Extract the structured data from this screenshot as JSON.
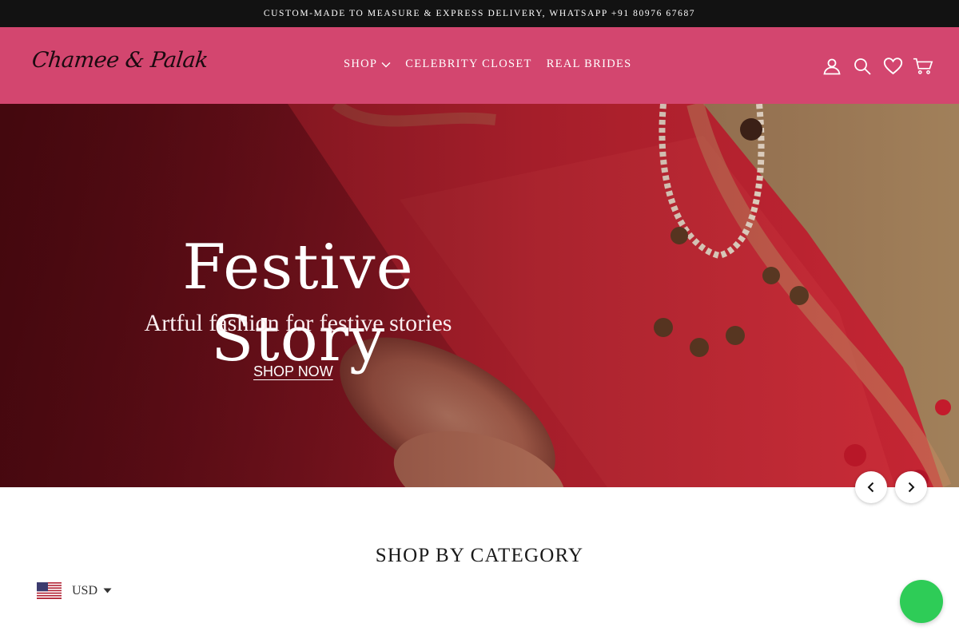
{
  "announcement": {
    "text": "CUSTOM-MADE TO MEASURE & EXPRESS DELIVERY, WHATSAPP +91 80976 67687"
  },
  "header": {
    "logo_text": "Chamee & Palak",
    "nav": [
      {
        "label": "SHOP"
      },
      {
        "label": "CELEBRITY CLOSET"
      },
      {
        "label": "REAL BRIDES"
      }
    ],
    "icons": [
      "account-icon",
      "search-icon",
      "wishlist-heart-icon",
      "cart-icon"
    ]
  },
  "hero": {
    "title": "Festive Story",
    "subtitle": "Artful fashion for festive stories",
    "cta": "SHOP NOW"
  },
  "slider": {
    "prev_icon": "chevron-left-icon",
    "next_icon": "chevron-right-icon"
  },
  "section": {
    "title": "SHOP BY CATEGORY"
  },
  "currency": {
    "code": "USD",
    "flag_icon": "us-flag-icon"
  },
  "colors": {
    "header_bg": "#d3466f",
    "announcement_bg": "#121212",
    "chat_button": "#2ecc57"
  }
}
